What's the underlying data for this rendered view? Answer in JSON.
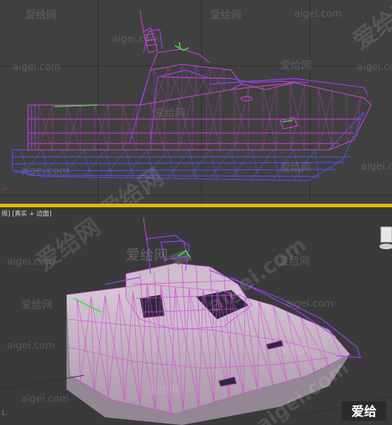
{
  "viewports": {
    "top": {
      "label": ""
    },
    "perspective": {
      "label": "视] [真实 + 边面]"
    }
  },
  "watermarks": {
    "aigei_cn": "爱给网",
    "aigei_com": "aigei.com"
  },
  "logo": {
    "text": "爱给"
  },
  "colors": {
    "wire_magenta": "#e040e0",
    "wire_violet": "#8a3cff",
    "wire_green": "#40e040",
    "hull_blue": "#5050ff",
    "border_active": "#e6b800",
    "viewport_bg": "#404040"
  },
  "icons": {
    "view_cube": "view-cube-icon",
    "axis_tripod": "axis-tripod-icon"
  }
}
